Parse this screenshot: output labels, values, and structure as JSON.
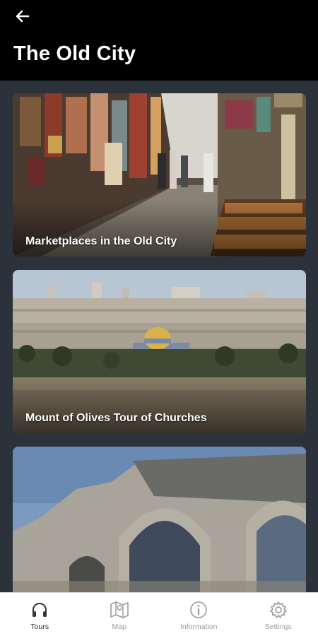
{
  "header": {
    "back_icon": "arrow-left-icon",
    "title": "The Old City"
  },
  "tours": [
    {
      "title": "Marketplaces in the Old City"
    },
    {
      "title": "Mount of Olives Tour of Churches"
    },
    {
      "title": ""
    }
  ],
  "bottom_nav": {
    "items": [
      {
        "label": "Tours",
        "icon": "headphones-icon",
        "active": true
      },
      {
        "label": "Map",
        "icon": "map-icon",
        "active": false
      },
      {
        "label": "Information",
        "icon": "info-icon",
        "active": false
      },
      {
        "label": "Settings",
        "icon": "gear-icon",
        "active": false
      }
    ]
  },
  "colors": {
    "header_bg": "#000000",
    "list_bg": "#2c323b",
    "nav_bg": "#ffffff",
    "nav_active": "#333333",
    "nav_inactive": "#9a9a9a"
  }
}
